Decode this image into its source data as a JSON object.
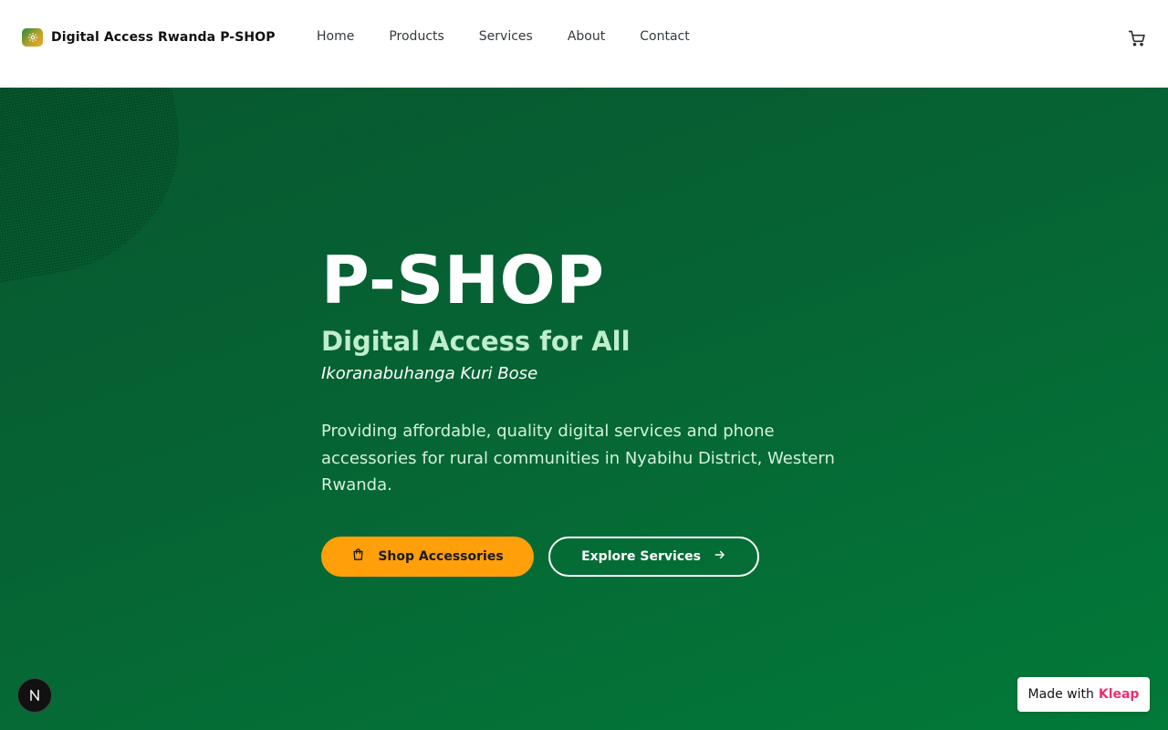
{
  "header": {
    "brand_name": "Digital Access Rwanda P-SHOP",
    "logo_icon": "gear-icon",
    "nav": [
      {
        "label": "Home"
      },
      {
        "label": "Products"
      },
      {
        "label": "Services"
      },
      {
        "label": "About"
      },
      {
        "label": "Contact"
      }
    ],
    "cart_icon": "cart-icon"
  },
  "hero": {
    "title": "P-SHOP",
    "subtitle": "Digital Access for All",
    "tagline": "Ikoranabuhanga Kuri Bose",
    "description": "Providing affordable, quality digital services and phone accessories for rural communities in Nyabihu District, Western Rwanda.",
    "primary_button": {
      "label": "Shop Accessories",
      "icon": "shopping-bag-icon"
    },
    "secondary_button": {
      "label": "Explore Services",
      "icon": "arrow-right-icon"
    }
  },
  "floating": {
    "n_badge_letter": "N",
    "made_with_prefix": "Made with",
    "made_with_brand": "Kleap"
  },
  "colors": {
    "hero_bg": "#066434",
    "primary_button": "#ff9f0a",
    "subtitle": "#bfeecd",
    "kleap_brand": "#ec2f70"
  }
}
